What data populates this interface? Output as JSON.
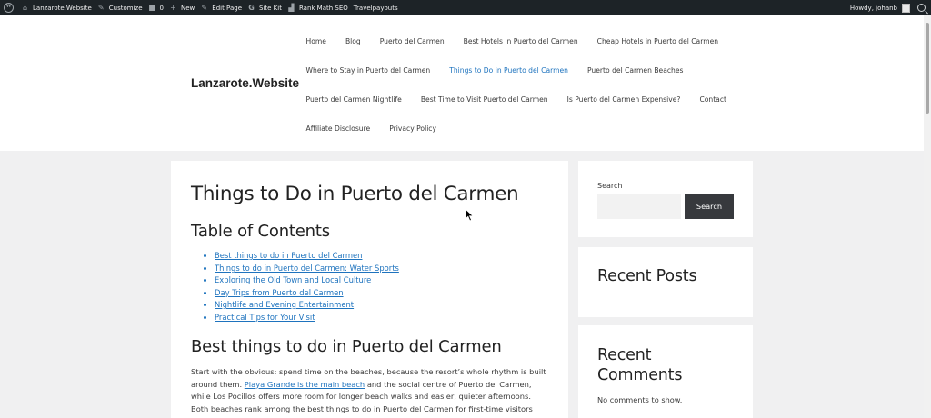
{
  "adminbar": {
    "items": [
      {
        "label": "Lanzarote.Website",
        "icon": "home-icon"
      },
      {
        "label": "Customize",
        "icon": "brush-icon"
      },
      {
        "label": "0",
        "icon": "comment-icon"
      },
      {
        "label": "New",
        "icon": "plus-icon"
      },
      {
        "label": "Edit Page",
        "icon": "pencil-icon"
      },
      {
        "label": "Site Kit",
        "icon": "google-icon"
      },
      {
        "label": "Rank Math SEO",
        "icon": "chart-icon"
      },
      {
        "label": "Travelpayouts",
        "icon": ""
      }
    ],
    "howdy": "Howdy, johanb"
  },
  "header": {
    "site_title": "Lanzarote.Website",
    "nav_rows": [
      [
        "Home",
        "Blog",
        "Puerto del Carmen",
        "Best Hotels in Puerto del Carmen",
        "Cheap Hotels in Puerto del Carmen"
      ],
      [
        "Where to Stay in Puerto del Carmen",
        "Things to Do in Puerto del Carmen",
        "Puerto del Carmen Beaches"
      ],
      [
        "Puerto del Carmen Nightlife",
        "Best Time to Visit Puerto del Carmen",
        "Is Puerto del Carmen Expensive?",
        "Contact"
      ],
      [
        "Affiliate Disclosure",
        "Privacy Policy"
      ]
    ],
    "active_item": "Things to Do in Puerto del Carmen"
  },
  "main": {
    "page_title": "Things to Do in Puerto del Carmen",
    "toc_title": "Table of Contents",
    "toc_items": [
      "Best things to do in Puerto del Carmen",
      "Things to do in Puerto del Carmen: Water Sports",
      "Exploring the Old Town and Local Culture",
      "Day Trips from Puerto del Carmen",
      "Nightlife and Evening Entertainment",
      "Practical Tips for Your Visit"
    ],
    "section_title": "Best things to do in Puerto del Carmen",
    "paragraph": {
      "before_link": "Start with the obvious: spend time on the beaches, because the resort’s whole rhythm is built around them. ",
      "link": "Playa Grande is the main beach",
      "after_link": " and the social centre of Puerto del Carmen, while Los Pocillos offers more room for longer beach walks and easier, quieter afternoons. Both beaches rank among the best things to do in Puerto del Carmen for first-time visitors and"
    }
  },
  "sidebar": {
    "search_label": "Search",
    "search_placeholder": "",
    "search_button": "Search",
    "recent_posts_title": "Recent Posts",
    "recent_comments_title": "Recent Comments",
    "no_comments": "No comments to show."
  },
  "colors": {
    "adminbar_bg": "#1d2327",
    "link": "#1e73be",
    "button_bg": "#37393d",
    "page_bg": "#f0f0f1"
  }
}
